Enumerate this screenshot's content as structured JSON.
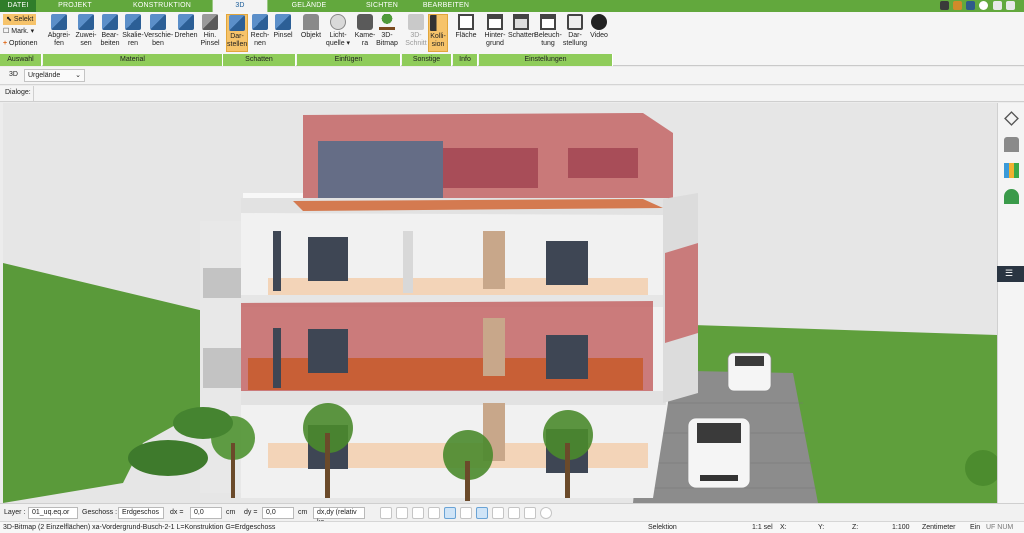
{
  "tabs": [
    "DATEI",
    "PROJEKT",
    "KONSTRUKTION",
    "3D",
    "GELÄNDE",
    "SICHTEN",
    "BEARBEITEN"
  ],
  "active_tab": "3D",
  "ribbon": {
    "auswahl": {
      "selekt": "Selekt",
      "mark": "Mark.",
      "optionen": "Optionen",
      "group": "Auswahl"
    },
    "material": {
      "buttons": [
        [
          "Abgrei-",
          "fen"
        ],
        [
          "Zuwei-",
          "sen"
        ],
        [
          "Bear-",
          "beiten"
        ],
        [
          "Skalie-",
          "ren"
        ],
        [
          "Verschie-",
          "ben"
        ],
        [
          "Drehen",
          ""
        ],
        [
          "Hin.",
          "Pinsel"
        ]
      ],
      "group": "Material"
    },
    "schatten": {
      "buttons": [
        [
          "Dar-",
          "stellen"
        ],
        [
          "Rech-",
          "nen"
        ],
        [
          "Pinsel",
          ""
        ]
      ],
      "group": "Schatten"
    },
    "einfuegen": {
      "buttons": [
        [
          "Objekt",
          ""
        ],
        [
          "Licht-",
          "quelle ▾"
        ],
        [
          "Kame-",
          "ra"
        ],
        [
          "3D-",
          "Bitmap"
        ]
      ],
      "group": "Einfügen"
    },
    "sonstige": {
      "buttons": [
        [
          "3D-",
          "Schnitt"
        ],
        [
          "Kolli-",
          "sion"
        ]
      ],
      "group": "Sonstige"
    },
    "info": {
      "buttons": [
        [
          "Fläche",
          ""
        ]
      ],
      "group": "Info"
    },
    "einstellungen": {
      "buttons": [
        [
          "Hinter-",
          "grund"
        ],
        [
          "Schatten",
          ""
        ],
        [
          "Beleuch-",
          "tung"
        ],
        [
          "Dar-",
          "stellung"
        ],
        [
          "Video",
          ""
        ]
      ],
      "group": "Einstellungen"
    }
  },
  "view_row": {
    "mode": "3D",
    "select_value": "Urgelände"
  },
  "dialog_row": {
    "label": "Dialoge:"
  },
  "bottom": {
    "layer_label": "Layer :",
    "layer_value": "01_uq.eq.or",
    "geschoss_label": "Geschoss :",
    "geschoss_value": "Erdgeschos",
    "dx_label": "dx =",
    "dx_value": "0,0",
    "dx_unit": "cm",
    "dy_label": "dy =",
    "dy_value": "0,0",
    "dy_unit": "cm",
    "mode_value": "dx,dy (relativ ka"
  },
  "status": {
    "text": "3D-Bitmap (2 Einzelflächen) xa-Vordergrund-Busch-2-1 L=Konstruktion G=Erdgeschoss",
    "selection": "Selektion",
    "scale_sel": "1:1 sel",
    "x": "X:",
    "y": "Y:",
    "z": "Z:",
    "scale": "1:100",
    "unit": "Zentimeter",
    "ein": "Ein",
    "flags": "UF  NUM  RF"
  },
  "colors": {
    "tab_green": "#62a83d",
    "group_green": "#8fcc5a",
    "highlight": "#f6c36a",
    "facade_red": "#c56a6a",
    "sky": "#e6e6e6",
    "grass": "#5a9a3a"
  }
}
